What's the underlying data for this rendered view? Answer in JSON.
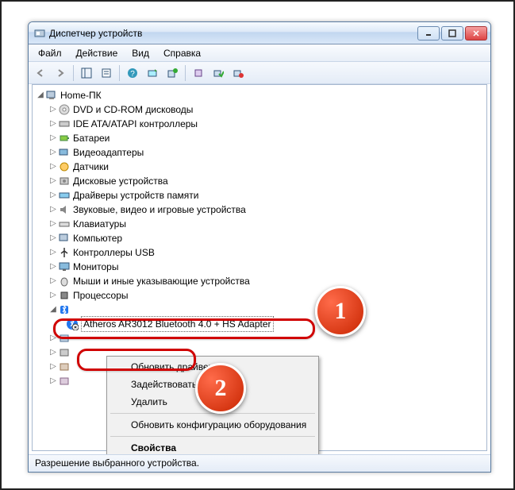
{
  "window": {
    "title": "Диспетчер устройств"
  },
  "menu": {
    "file": "Файл",
    "action": "Действие",
    "view": "Вид",
    "help": "Справка"
  },
  "tree": {
    "root": "Home-ПК",
    "categories": [
      "DVD и CD-ROM дисководы",
      "IDE ATA/ATAPI контроллеры",
      "Батареи",
      "Видеоадаптеры",
      "Датчики",
      "Дисковые устройства",
      "Драйверы устройств памяти",
      "Звуковые, видео и игровые устройства",
      "Клавиатуры",
      "Компьютер",
      "Контроллеры USB",
      "Мониторы",
      "Мыши и иные указывающие устройства",
      "Процессоры"
    ],
    "selected_device": "Atheros AR3012 Bluetooth 4.0 + HS Adapter"
  },
  "context_menu": {
    "update": "Обновить драйверы...",
    "enable": "Задействовать",
    "delete": "Удалить",
    "scan": "Обновить конфигурацию оборудования",
    "properties": "Свойства"
  },
  "badges": {
    "one": "1",
    "two": "2"
  },
  "statusbar": {
    "text": "Разрешение выбранного устройства."
  }
}
